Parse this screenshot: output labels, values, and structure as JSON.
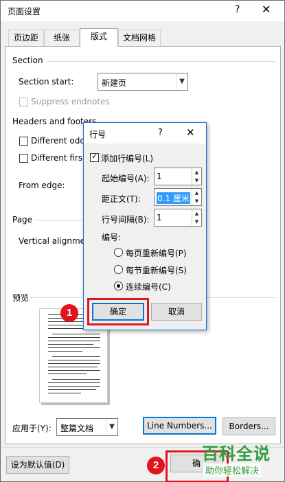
{
  "window": {
    "title": "页面设置",
    "help": "?",
    "close": "✕"
  },
  "tabs": [
    "页边距",
    "纸张",
    "版式",
    "文档网格"
  ],
  "section": {
    "heading": "Section",
    "start_label": "Section start:",
    "start_value": "新建页",
    "suppress_endnotes": "Suppress endnotes"
  },
  "headers_footers": {
    "heading": "Headers and footers",
    "diff_odd": "Different odd",
    "diff_first": "Different first",
    "from_edge": "From edge:"
  },
  "page": {
    "heading": "Page",
    "vertical_alignment": "Vertical alignmer"
  },
  "preview": {
    "heading": "预览"
  },
  "apply": {
    "label": "应用于(Y):",
    "value": "整篇文档"
  },
  "buttons": {
    "line_numbers": "Line Numbers...",
    "borders": "Borders...",
    "set_default": "设为默认值(D)",
    "ok_partial": "确"
  },
  "line_dialog": {
    "title": "行号",
    "help": "?",
    "close": "✕",
    "add_line_numbers": "添加行编号(L)",
    "start_at_label": "起始编号(A):",
    "start_at_value": "1",
    "from_text_label": "距正文(T):",
    "from_text_value": "0.1 厘米",
    "count_by_label": "行号间隔(B):",
    "count_by_value": "1",
    "numbering_label": "编号:",
    "restart_page": "每页重新编号(P)",
    "restart_section": "每节重新编号(S)",
    "continuous": "连续编号(C)",
    "ok": "确定",
    "cancel": "取消"
  },
  "badges": [
    "1",
    "2"
  ],
  "watermark": {
    "big": "百科全说",
    "small": "助你轻松解决"
  },
  "colors": {
    "accent": "#0078d7",
    "highlight": "#e1141c",
    "watermark": "#2e9e3e"
  }
}
